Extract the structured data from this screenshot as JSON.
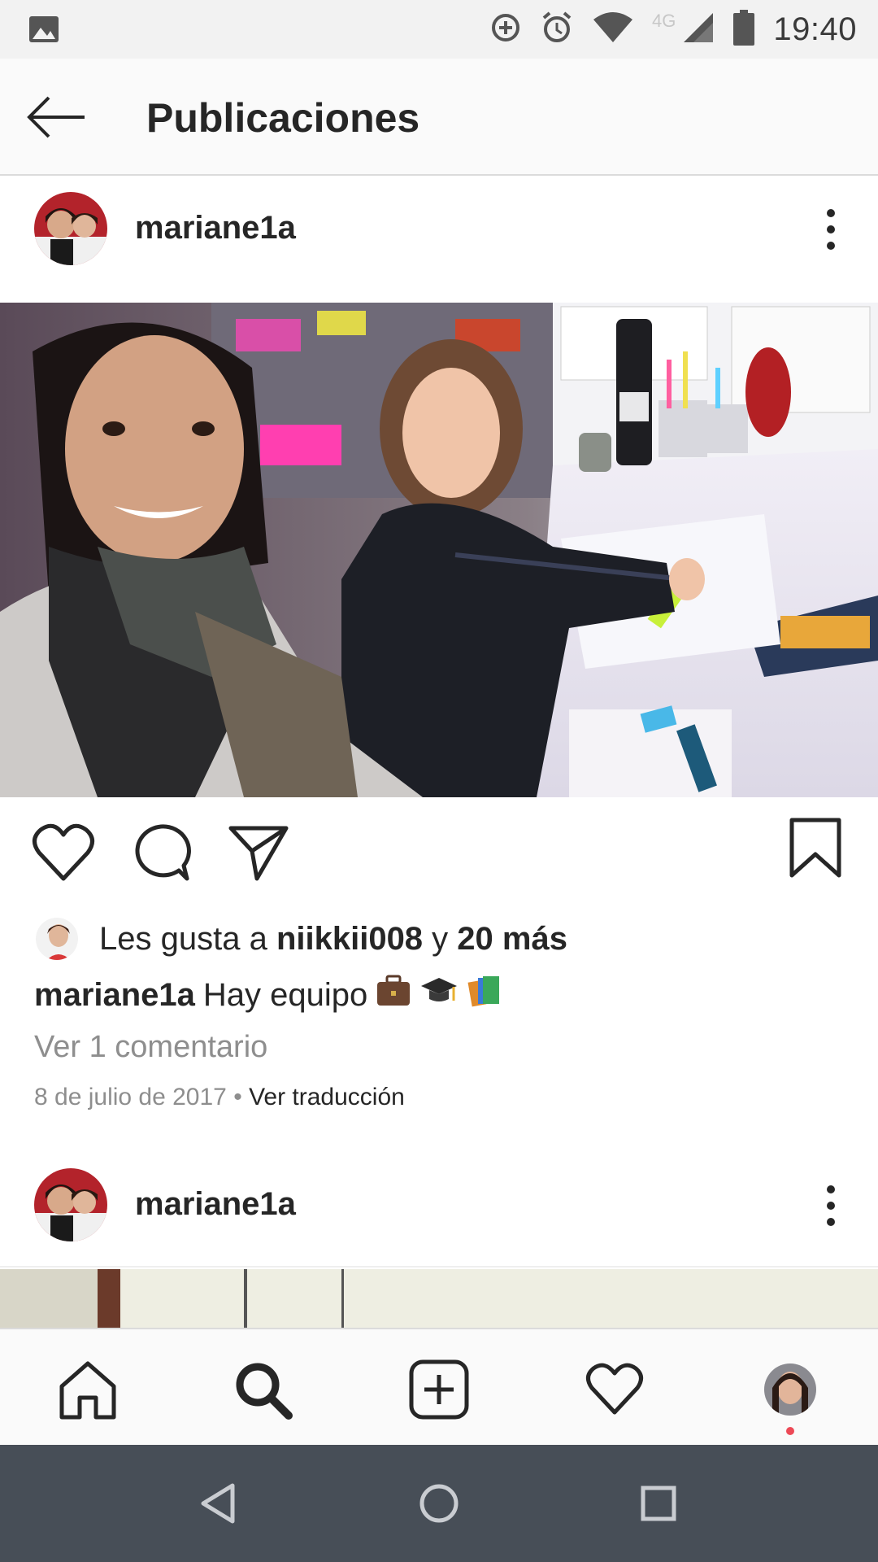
{
  "status_bar": {
    "time": "19:40",
    "network": "4G",
    "icons": [
      "image-icon",
      "data-saver-icon",
      "alarm-icon",
      "wifi-icon",
      "signal-icon",
      "battery-icon"
    ]
  },
  "app_bar": {
    "title": "Publicaciones",
    "back_icon": "arrow-left-icon"
  },
  "posts": [
    {
      "username": "mariane1a",
      "likes": {
        "prefix": "Les gusta a ",
        "liker": "niikkii008",
        "connector": " y ",
        "others": "20 más"
      },
      "caption": {
        "username": "mariane1a",
        "text": "Hay equipo",
        "emojis": [
          "briefcase-emoji",
          "graduation-cap-emoji",
          "books-emoji"
        ]
      },
      "view_comments": "Ver 1 comentario",
      "date": "8 de julio de 2017",
      "separator": " • ",
      "translate": "Ver traducción"
    },
    {
      "username": "mariane1a"
    }
  ],
  "bottom_nav": [
    "home-icon",
    "search-icon",
    "new-post-icon",
    "activity-heart-icon",
    "profile-avatar"
  ],
  "system_nav": [
    "back-triangle-icon",
    "home-circle-icon",
    "recents-square-icon"
  ],
  "colors": {
    "text": "#262626",
    "secondary": "#8e8e8e",
    "notification": "#ed4956",
    "system_nav_bg": "#474e57"
  }
}
